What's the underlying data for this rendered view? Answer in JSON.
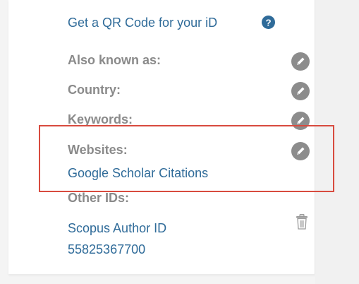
{
  "qr": {
    "link_label": "Get a QR Code for your iD",
    "help_icon": "question-circle-icon"
  },
  "sections": {
    "also_known_as": {
      "label": "Also known as:",
      "edit_icon": "pencil-icon"
    },
    "country": {
      "label": "Country:",
      "edit_icon": "pencil-icon"
    },
    "keywords": {
      "label": "Keywords:",
      "edit_icon": "pencil-icon"
    },
    "websites": {
      "label": "Websites:",
      "edit_icon": "pencil-icon",
      "links": [
        "Google Scholar Citations"
      ]
    },
    "other_ids": {
      "label": "Other IDs:",
      "delete_icon": "trash-icon",
      "items": [
        {
          "name": "Scopus Author ID",
          "id": "55825367700"
        }
      ]
    }
  },
  "colors": {
    "link": "#2f6b99",
    "label": "#8a8a8a",
    "icon": "#888888",
    "highlight": "#d84b3f"
  }
}
